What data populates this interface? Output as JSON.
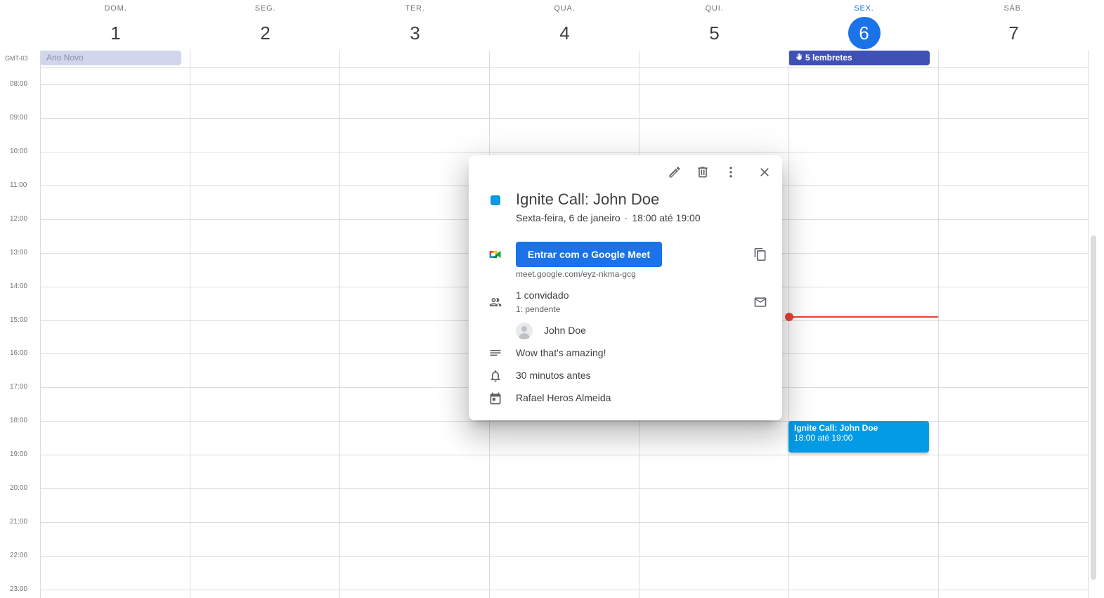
{
  "days": [
    {
      "name": "DOM.",
      "num": "1"
    },
    {
      "name": "SEG.",
      "num": "2"
    },
    {
      "name": "TER.",
      "num": "3"
    },
    {
      "name": "QUA.",
      "num": "4"
    },
    {
      "name": "QUI.",
      "num": "5"
    },
    {
      "name": "SEX.",
      "num": "6"
    },
    {
      "name": "SÁB.",
      "num": "7"
    }
  ],
  "timezone": "GMT-03",
  "all_day": {
    "holiday": "Ano Novo",
    "reminders": "5 lembretes"
  },
  "hours": [
    "08:00",
    "09:00",
    "10:00",
    "11:00",
    "12:00",
    "13:00",
    "14:00",
    "15:00",
    "16:00",
    "17:00",
    "18:00",
    "19:00",
    "20:00",
    "21:00",
    "22:00",
    "23:00"
  ],
  "event": {
    "title": "Ignite Call: John Doe",
    "time": "18:00 até 19:00",
    "color": "#039be5"
  },
  "popup": {
    "title": "Ignite Call: John Doe",
    "date": "Sexta-feira, 6 de janeiro",
    "separator": "·",
    "time": "18:00 até 19:00",
    "meet_button": "Entrar com o Google Meet",
    "meet_link": "meet.google.com/eyz-nkma-gcg",
    "guests_count": "1 convidado",
    "guests_status": "1: pendente",
    "guest_name": "John Doe",
    "description": "Wow that's amazing!",
    "reminder": "30 minutos antes",
    "calendar": "Rafael Heros Almeida"
  },
  "colors": {
    "today": "#1a73e8",
    "now_line": "#ea4335",
    "reminder_chip": "#3f51b5",
    "holiday_chip": "#d2d6ec"
  }
}
